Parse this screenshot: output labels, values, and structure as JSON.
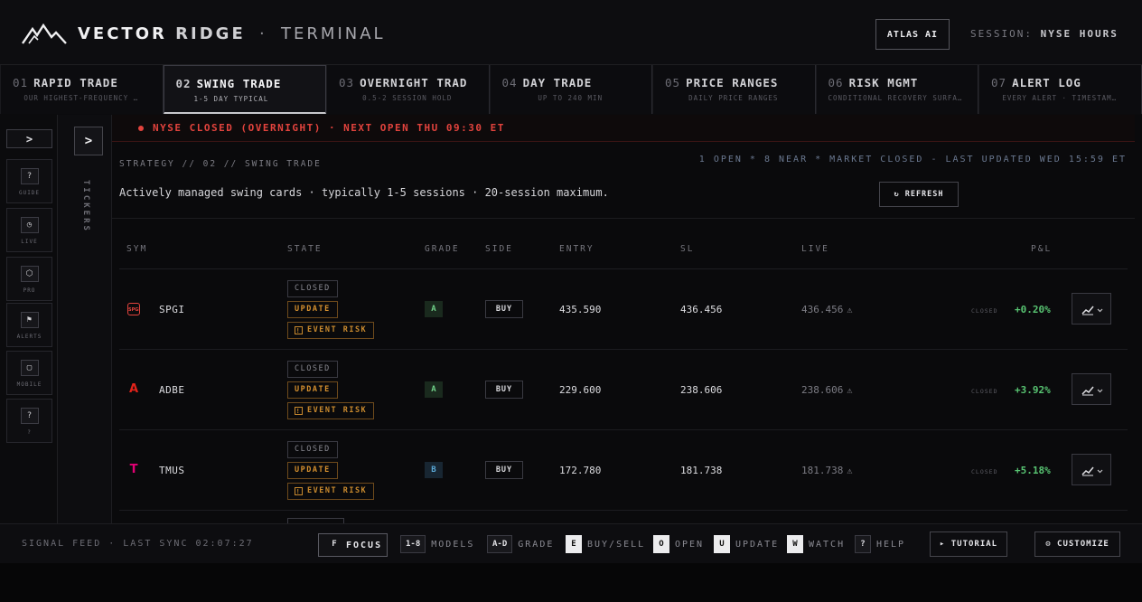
{
  "header": {
    "brand_1": "VECTOR",
    "brand_2": "RIDGE",
    "brand_sep": "·",
    "brand_3": "TERMINAL",
    "atlas_label": "ATLAS AI",
    "session_label": "SESSION:",
    "session_value": "NYSE HOURS"
  },
  "tabs": [
    {
      "num": "01",
      "label": "RAPID TRADE",
      "sub": "OUR HIGHEST-FREQUENCY …"
    },
    {
      "num": "02",
      "label": "SWING TRADE",
      "sub": "1-5 DAY TYPICAL"
    },
    {
      "num": "03",
      "label": "OVERNIGHT TRAD",
      "sub": "0.5-2 SESSION HOLD"
    },
    {
      "num": "04",
      "label": "DAY TRADE",
      "sub": "UP TO 240 MIN"
    },
    {
      "num": "05",
      "label": "PRICE RANGES",
      "sub": "DAILY PRICE RANGES"
    },
    {
      "num": "06",
      "label": "RISK MGMT",
      "sub": "CONDITIONAL RECOVERY SURFACE"
    },
    {
      "num": "07",
      "label": "ALERT LOG",
      "sub": "EVERY ALERT · TIMESTAM…"
    }
  ],
  "rail": {
    "toggle": ">",
    "items": [
      {
        "icon": "?",
        "label": "GUIDE"
      },
      {
        "icon": "◷",
        "label": "LIVE"
      },
      {
        "icon": "⬡",
        "label": "PRO"
      },
      {
        "icon": "⚑",
        "label": "ALERTS"
      },
      {
        "icon": "▢",
        "label": "MOBILE"
      },
      {
        "icon": "?",
        "label": "?"
      }
    ]
  },
  "tickers": {
    "button": ">",
    "label": "TICKERS"
  },
  "main": {
    "alert": "NYSE CLOSED (OVERNIGHT) · NEXT OPEN THU 09:30 ET",
    "strategy": "STRATEGY // 02 // SWING TRADE",
    "status": "1 OPEN * 8 NEAR * MARKET CLOSED - LAST UPDATED WED 15:59 ET",
    "description": "Actively managed swing cards · typically 1-5 sessions · 20-session maximum.",
    "refresh_icon": "↻",
    "refresh_label": "REFRESH"
  },
  "table": {
    "headers": {
      "sym": "SYM",
      "state": "STATE",
      "grade": "GRADE",
      "side": "SIDE",
      "entry": "ENTRY",
      "sl": "SL",
      "live": "LIVE",
      "pl": "P&L"
    },
    "rows": [
      {
        "logo": "SPGI",
        "logo_color": "#e2433d",
        "sym": "SPGI",
        "state_1": "CLOSED",
        "state_2": "UPDATE",
        "state_3": "EVENT RISK",
        "grade": "A",
        "side": "BUY",
        "entry": "435.590",
        "sl": "436.456",
        "live": "436.456",
        "pl_status": "CLOSED",
        "pl": "+0.20%"
      },
      {
        "logo": "A",
        "logo_color": "#e2231a",
        "sym": "ADBE",
        "state_1": "CLOSED",
        "state_2": "UPDATE",
        "state_3": "EVENT RISK",
        "grade": "A",
        "side": "BUY",
        "entry": "229.600",
        "sl": "238.606",
        "live": "238.606",
        "pl_status": "CLOSED",
        "pl": "+3.92%"
      },
      {
        "logo": "T",
        "logo_color": "#e20074",
        "sym": "TMUS",
        "state_1": "CLOSED",
        "state_2": "UPDATE",
        "state_3": "EVENT RISK",
        "grade": "B",
        "side": "BUY",
        "entry": "172.780",
        "sl": "181.738",
        "live": "181.738",
        "pl_status": "CLOSED",
        "pl": "+5.18%"
      }
    ]
  },
  "footer": {
    "feed": "SIGNAL FEED · LAST SYNC 02:07:27",
    "focus_key": "F",
    "focus_label": "FOCUS",
    "shortcuts": [
      {
        "key": "1-8",
        "label": "MODELS"
      },
      {
        "key": "A-D",
        "label": "GRADE"
      },
      {
        "key": "E",
        "label": "BUY/SELL"
      },
      {
        "key": "O",
        "label": "OPEN"
      },
      {
        "key": "U",
        "label": "UPDATE"
      },
      {
        "key": "W",
        "label": "WATCH"
      },
      {
        "key": "?",
        "label": "HELP"
      }
    ],
    "tutorial": "▸ TUTORIAL",
    "customize": "⚙ CUSTOMIZE"
  },
  "colors": {
    "accent_red": "#e2433d",
    "profit_green": "#58c472",
    "warn_orange": "#d6902e"
  }
}
